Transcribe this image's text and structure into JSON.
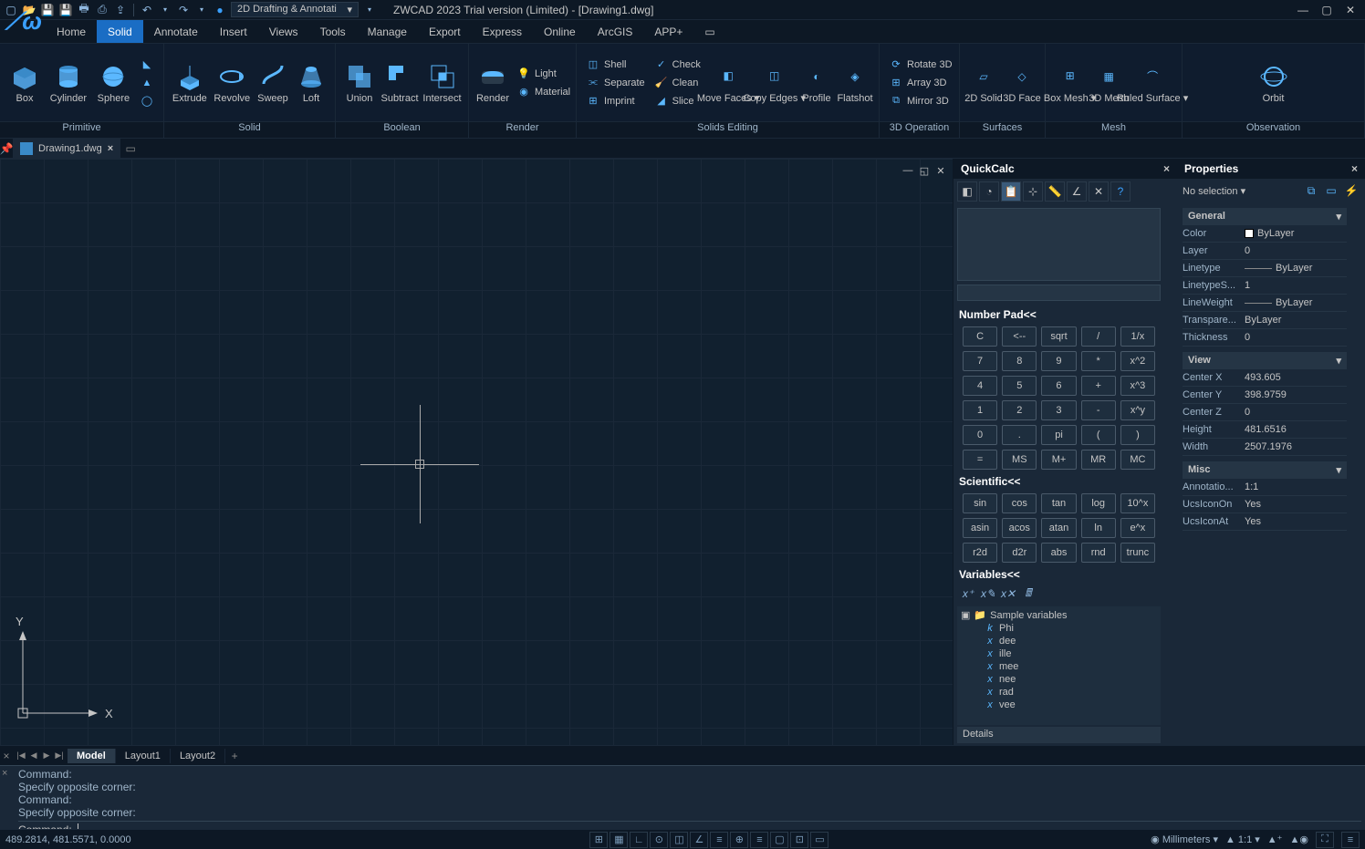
{
  "title": "ZWCAD 2023 Trial version (Limited) - [Drawing1.dwg]",
  "workspace": "2D Drafting & Annotati",
  "menu": [
    "Home",
    "Solid",
    "Annotate",
    "Insert",
    "Views",
    "Tools",
    "Manage",
    "Export",
    "Express",
    "Online",
    "ArcGIS",
    "APP+"
  ],
  "activeMenu": "Solid",
  "ribbon": {
    "primitive": {
      "title": "Primitive",
      "btns": [
        "Box",
        "Cylinder",
        "Sphere"
      ]
    },
    "solid": {
      "title": "Solid",
      "btns": [
        "Extrude",
        "Revolve",
        "Sweep",
        "Loft"
      ]
    },
    "boolean": {
      "title": "Boolean",
      "btns": [
        "Union",
        "Subtract",
        "Intersect"
      ]
    },
    "render": {
      "title": "Render",
      "btn": "Render",
      "items": [
        "Light",
        "Material"
      ]
    },
    "solids_editing": {
      "title": "Solids Editing",
      "col1": [
        "Shell",
        "Separate",
        "Imprint"
      ],
      "col2": [
        "Check",
        "Clean",
        "Slice"
      ],
      "btns": [
        "Move Faces",
        "Copy Edges",
        "Profile",
        "Flatshot"
      ]
    },
    "op3d": {
      "title": "3D Operation",
      "items": [
        "Rotate 3D",
        "Array 3D",
        "Mirror 3D"
      ]
    },
    "surfaces": {
      "title": "Surfaces",
      "btns": [
        "2D Solid",
        "3D Face"
      ]
    },
    "mesh": {
      "title": "Mesh",
      "btns": [
        "Box Mesh",
        "3D Mesh",
        "Ruled Surface"
      ]
    },
    "observation": {
      "title": "Observation",
      "btn": "Orbit"
    }
  },
  "tab": {
    "name": "Drawing1.dwg"
  },
  "quickcalc": {
    "title": "QuickCalc",
    "numpad_title": "Number Pad<<",
    "numpad": [
      [
        "C",
        "<--",
        "sqrt",
        "/",
        "1/x"
      ],
      [
        "7",
        "8",
        "9",
        "*",
        "x^2"
      ],
      [
        "4",
        "5",
        "6",
        "+",
        "x^3"
      ],
      [
        "1",
        "2",
        "3",
        "-",
        "x^y"
      ],
      [
        "0",
        ".",
        "pi",
        "(",
        ")"
      ],
      [
        "=",
        "MS",
        "M+",
        "MR",
        "MC"
      ]
    ],
    "sci_title": "Scientific<<",
    "sci": [
      [
        "sin",
        "cos",
        "tan",
        "log",
        "10^x"
      ],
      [
        "asin",
        "acos",
        "atan",
        "ln",
        "e^x"
      ],
      [
        "r2d",
        "d2r",
        "abs",
        "rnd",
        "trunc"
      ]
    ],
    "vars_title": "Variables<<",
    "vars_root": "Sample variables",
    "vars": [
      "Phi",
      "dee",
      "ille",
      "mee",
      "nee",
      "rad",
      "vee"
    ],
    "details": "Details"
  },
  "properties": {
    "title": "Properties",
    "selection": "No selection",
    "general": {
      "title": "General",
      "rows": [
        [
          "Color",
          "ByLayer"
        ],
        [
          "Layer",
          "0"
        ],
        [
          "Linetype",
          "ByLayer"
        ],
        [
          "LinetypeS...",
          "1"
        ],
        [
          "LineWeight",
          "ByLayer"
        ],
        [
          "Transpare...",
          "ByLayer"
        ],
        [
          "Thickness",
          "0"
        ]
      ]
    },
    "view": {
      "title": "View",
      "rows": [
        [
          "Center X",
          "493.605"
        ],
        [
          "Center Y",
          "398.9759"
        ],
        [
          "Center Z",
          "0"
        ],
        [
          "Height",
          "481.6516"
        ],
        [
          "Width",
          "2507.1976"
        ]
      ]
    },
    "misc": {
      "title": "Misc",
      "rows": [
        [
          "Annotatio...",
          "1:1"
        ],
        [
          "UcsIconOn",
          "Yes"
        ],
        [
          "UcsIconAt",
          "Yes"
        ]
      ]
    }
  },
  "layouts": {
    "tabs": [
      "Model",
      "Layout1",
      "Layout2"
    ],
    "active": "Model"
  },
  "cmd": {
    "hist": [
      "Command:",
      "Specify opposite corner:",
      "Command:",
      "Specify opposite corner:"
    ],
    "prompt": "Command:"
  },
  "status": {
    "coords": "489.2814, 481.5571, 0.0000",
    "units": "Millimeters",
    "scale": "1:1"
  }
}
